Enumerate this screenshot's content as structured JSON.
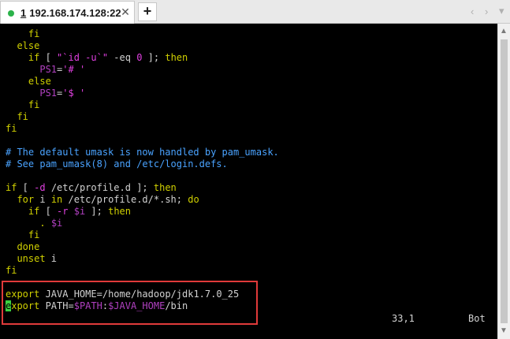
{
  "tab": {
    "number": "1",
    "host": "192.168.174.128:22",
    "close_symbol": "✕",
    "status_color": "#2bb34a"
  },
  "toolbar": {
    "add_symbol": "+",
    "nav_left_symbol": "‹",
    "nav_right_symbol": "›",
    "menu_symbol": "▾"
  },
  "terminal": {
    "lines": [
      [
        {
          "t": "    ",
          "s": "default"
        },
        {
          "t": "fi",
          "s": "keyword"
        }
      ],
      [
        {
          "t": "  ",
          "s": "default"
        },
        {
          "t": "else",
          "s": "keyword"
        }
      ],
      [
        {
          "t": "    ",
          "s": "default"
        },
        {
          "t": "if",
          "s": "keyword"
        },
        {
          "t": " [ ",
          "s": "default"
        },
        {
          "t": "\"`id -u`\"",
          "s": "string"
        },
        {
          "t": " -eq ",
          "s": "default"
        },
        {
          "t": "0",
          "s": "string"
        },
        {
          "t": " ]; ",
          "s": "default"
        },
        {
          "t": "then",
          "s": "keyword"
        }
      ],
      [
        {
          "t": "      ",
          "s": "default"
        },
        {
          "t": "PS1",
          "s": "variable"
        },
        {
          "t": "=",
          "s": "operator"
        },
        {
          "t": "'# '",
          "s": "string"
        }
      ],
      [
        {
          "t": "    ",
          "s": "default"
        },
        {
          "t": "else",
          "s": "keyword"
        }
      ],
      [
        {
          "t": "      ",
          "s": "default"
        },
        {
          "t": "PS1",
          "s": "variable"
        },
        {
          "t": "=",
          "s": "operator"
        },
        {
          "t": "'$ '",
          "s": "string"
        }
      ],
      [
        {
          "t": "    ",
          "s": "default"
        },
        {
          "t": "fi",
          "s": "keyword"
        }
      ],
      [
        {
          "t": "  ",
          "s": "default"
        },
        {
          "t": "fi",
          "s": "keyword"
        }
      ],
      [
        {
          "t": "fi",
          "s": "keyword"
        }
      ],
      [
        {
          "t": "",
          "s": "default"
        }
      ],
      [
        {
          "t": "# The default umask is now handled by pam_umask.",
          "s": "comment"
        }
      ],
      [
        {
          "t": "# See pam_umask(8) and /etc/login.defs.",
          "s": "comment"
        }
      ],
      [
        {
          "t": "",
          "s": "default"
        }
      ],
      [
        {
          "t": "if",
          "s": "keyword"
        },
        {
          "t": " [ ",
          "s": "default"
        },
        {
          "t": "-d",
          "s": "string"
        },
        {
          "t": " /etc/profile.d ]; ",
          "s": "default"
        },
        {
          "t": "then",
          "s": "keyword"
        }
      ],
      [
        {
          "t": "  ",
          "s": "default"
        },
        {
          "t": "for",
          "s": "keyword"
        },
        {
          "t": " i ",
          "s": "default"
        },
        {
          "t": "in",
          "s": "keyword"
        },
        {
          "t": " /etc/profile.d/*.sh; ",
          "s": "default"
        },
        {
          "t": "do",
          "s": "keyword"
        }
      ],
      [
        {
          "t": "    ",
          "s": "default"
        },
        {
          "t": "if",
          "s": "keyword"
        },
        {
          "t": " [ ",
          "s": "default"
        },
        {
          "t": "-r",
          "s": "string"
        },
        {
          "t": " ",
          "s": "default"
        },
        {
          "t": "$i",
          "s": "variable"
        },
        {
          "t": " ]; ",
          "s": "default"
        },
        {
          "t": "then",
          "s": "keyword"
        }
      ],
      [
        {
          "t": "      ",
          "s": "default"
        },
        {
          "t": ".",
          "s": "keyword"
        },
        {
          "t": " ",
          "s": "default"
        },
        {
          "t": "$i",
          "s": "variable"
        }
      ],
      [
        {
          "t": "    ",
          "s": "default"
        },
        {
          "t": "fi",
          "s": "keyword"
        }
      ],
      [
        {
          "t": "  ",
          "s": "default"
        },
        {
          "t": "done",
          "s": "keyword"
        }
      ],
      [
        {
          "t": "  ",
          "s": "default"
        },
        {
          "t": "unset",
          "s": "keyword"
        },
        {
          "t": " i",
          "s": "default"
        }
      ],
      [
        {
          "t": "fi",
          "s": "keyword"
        }
      ],
      [
        {
          "t": "",
          "s": "default"
        }
      ],
      [
        {
          "t": "export",
          "s": "keyword"
        },
        {
          "t": " JAVA_HOME",
          "s": "default"
        },
        {
          "t": "=",
          "s": "operator"
        },
        {
          "t": "/home/hadoop/jdk1.7.0_25",
          "s": "default"
        }
      ],
      [
        {
          "t": "e",
          "s": "cursor"
        },
        {
          "t": "xport",
          "s": "keyword"
        },
        {
          "t": " PATH",
          "s": "default"
        },
        {
          "t": "=",
          "s": "operator"
        },
        {
          "t": "$PATH",
          "s": "variable"
        },
        {
          "t": ":",
          "s": "default"
        },
        {
          "t": "$JAVA_HOME",
          "s": "variable"
        },
        {
          "t": "/bin",
          "s": "default"
        }
      ]
    ]
  },
  "status": {
    "position": "33,1",
    "scroll": "Bot"
  },
  "scrollbar": {
    "up_symbol": "▲",
    "down_symbol": "▼"
  },
  "colors": {
    "terminal_bg": "#000000",
    "highlight_border": "#e03a3a",
    "keyword": "#d0d000",
    "string": "#e040e0",
    "comment": "#4aa3ff",
    "variable": "#b040c0",
    "cursor": "#3cd040"
  }
}
